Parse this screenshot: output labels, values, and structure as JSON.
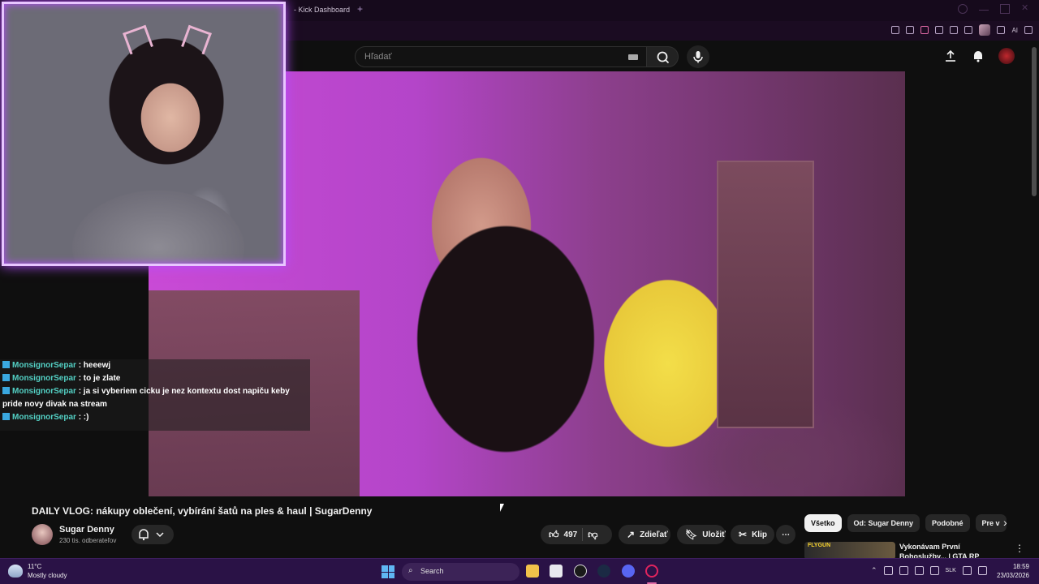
{
  "browser": {
    "tab_title": "- Kick Dashboard",
    "new_tab": "+",
    "toolbar_ai": "AI"
  },
  "header": {
    "search_placeholder": "Hľadať"
  },
  "chat": [
    {
      "user": "MonsignorSepar",
      "message": ": heeewj"
    },
    {
      "user": "MonsignorSepar",
      "message": ": to je zlate"
    },
    {
      "user": "MonsignorSepar",
      "message": ": ja si vyberiem cicku je nez kontextu dost napiču keby pride novy divak na stream"
    },
    {
      "user": "MonsignorSepar",
      "message": ": :)"
    }
  ],
  "video": {
    "title": "DAILY VLOG: nákupy oblečení, vybírání šatů na ples & haul | SugarDenny",
    "channel": "Sugar Denny",
    "subscribers": "230 tis. odberateľov",
    "likes": "497",
    "share_label": "Zdieľať",
    "save_label": "Uložiť",
    "clip_label": "Klip",
    "more_label": "⋯"
  },
  "chips": [
    "Všetko",
    "Od: Sugar Denny",
    "Podobné",
    "Pre v"
  ],
  "recommendation": {
    "thumb_brand": "FLYGUN",
    "title": "Vykonávam První Bohoslužby... | GTA RP"
  },
  "taskbar": {
    "temperature": "11°C",
    "weather": "Mostly cloudy",
    "search_label": "Search",
    "lang": "SLK",
    "time": "18:59",
    "date": "23/03/2026"
  },
  "colors": {
    "chat_user": "#53d0c4",
    "overlay_glow": "#b54cff",
    "taskbar": "#2a1246"
  }
}
